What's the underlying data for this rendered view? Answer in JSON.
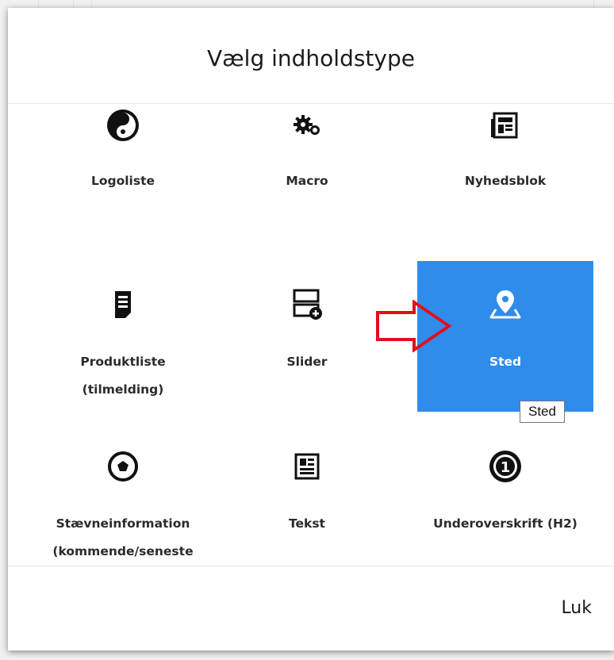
{
  "dialog": {
    "title": "Vælg indholdstype",
    "close_label": "Luk"
  },
  "items": [
    {
      "label": "Logoliste",
      "icon": "yin-yang-icon"
    },
    {
      "label": "Macro",
      "icon": "gears-icon"
    },
    {
      "label": "Nyhedsblok",
      "icon": "newspaper-icon"
    },
    {
      "label": "Produktliste (tilmelding)",
      "icon": "document-list-icon"
    },
    {
      "label": "Slider",
      "icon": "slider-add-icon"
    },
    {
      "label": "Sted",
      "icon": "map-location-icon",
      "selected": true
    },
    {
      "label": "Stævneinformation (kommende/seneste",
      "icon": "soccer-ball-icon"
    },
    {
      "label": "Tekst",
      "icon": "text-document-icon"
    },
    {
      "label": "Underoverskrift (H2)",
      "icon": "number-one-icon"
    }
  ],
  "tooltip": "Sted",
  "colors": {
    "selected_bg": "#2f8cea",
    "annotation_arrow": "#e0101d"
  }
}
